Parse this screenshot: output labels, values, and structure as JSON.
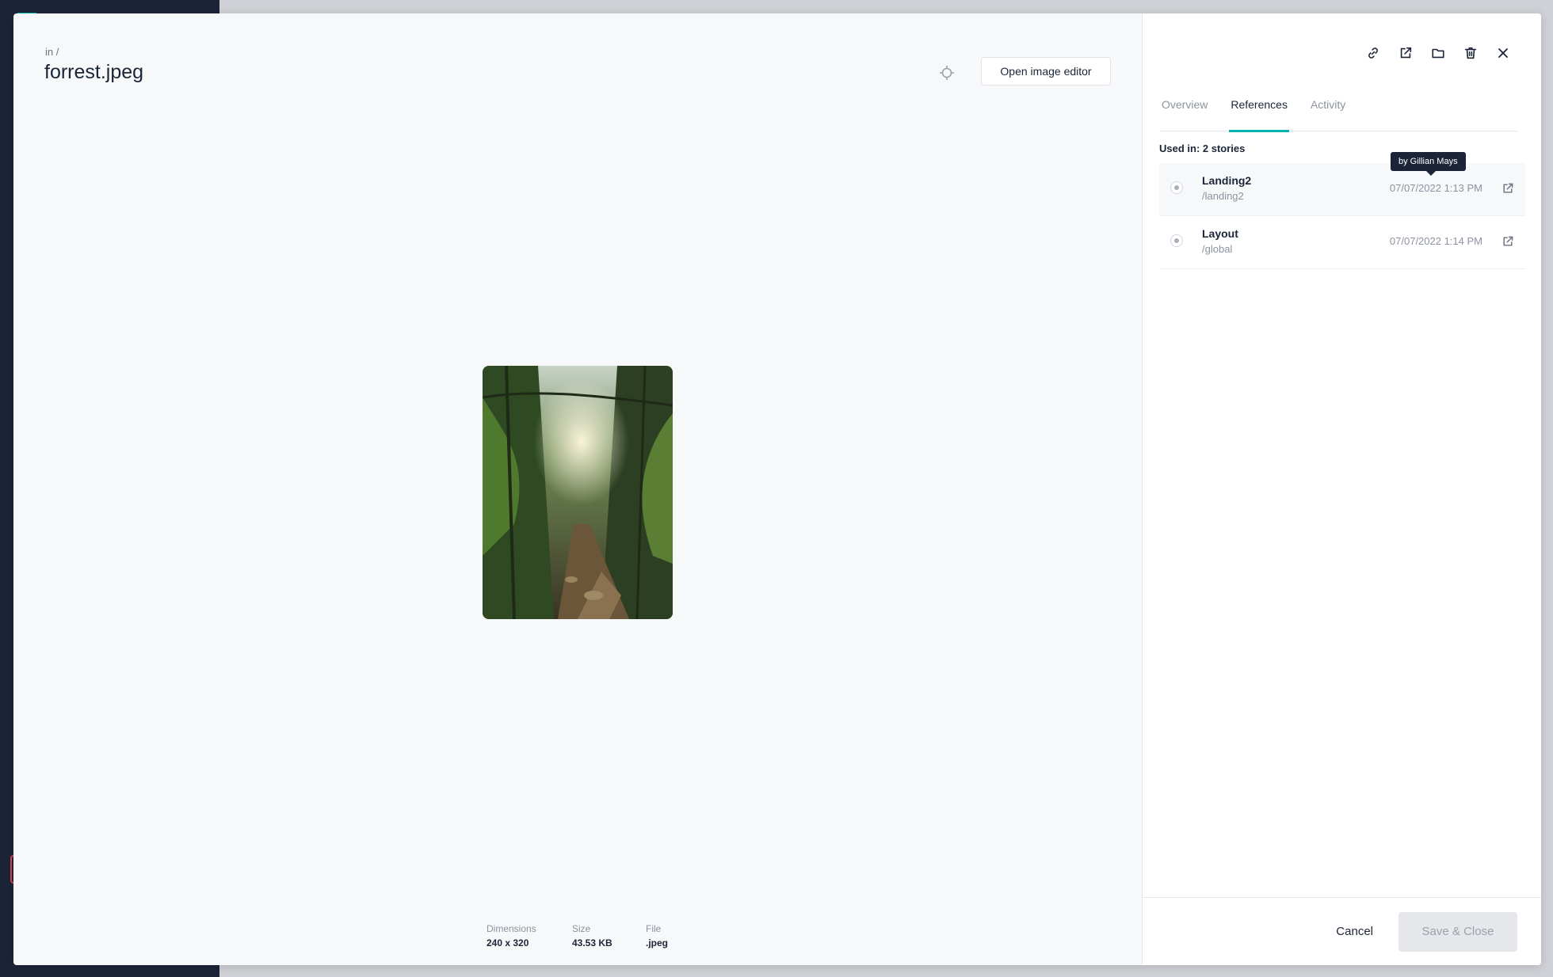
{
  "header": {
    "breadcrumb": "in /",
    "title": "forrest.jpeg",
    "open_editor_label": "Open image editor"
  },
  "toolbar": {
    "icons": [
      "link-icon",
      "external-link-icon",
      "folder-icon",
      "trash-icon",
      "close-icon"
    ]
  },
  "tabs": [
    {
      "label": "Overview",
      "active": false
    },
    {
      "label": "References",
      "active": true
    },
    {
      "label": "Activity",
      "active": false
    }
  ],
  "references": {
    "used_in": "Used in: 2 stories",
    "items": [
      {
        "name": "Landing2",
        "path": "/landing2",
        "date": "07/07/2022 1:13 PM"
      },
      {
        "name": "Layout",
        "path": "/global",
        "date": "07/07/2022 1:14 PM"
      }
    ],
    "tooltip": "by Gillian Mays"
  },
  "meta": {
    "dimensions_label": "Dimensions",
    "dimensions_value": "240 x 320",
    "size_label": "Size",
    "size_value": "43.53 KB",
    "file_label": "File",
    "file_value": ".jpeg"
  },
  "footer": {
    "cancel_label": "Cancel",
    "save_label": "Save & Close"
  },
  "colors": {
    "accent": "#00b3b0",
    "sidebar": "#1b2537"
  }
}
